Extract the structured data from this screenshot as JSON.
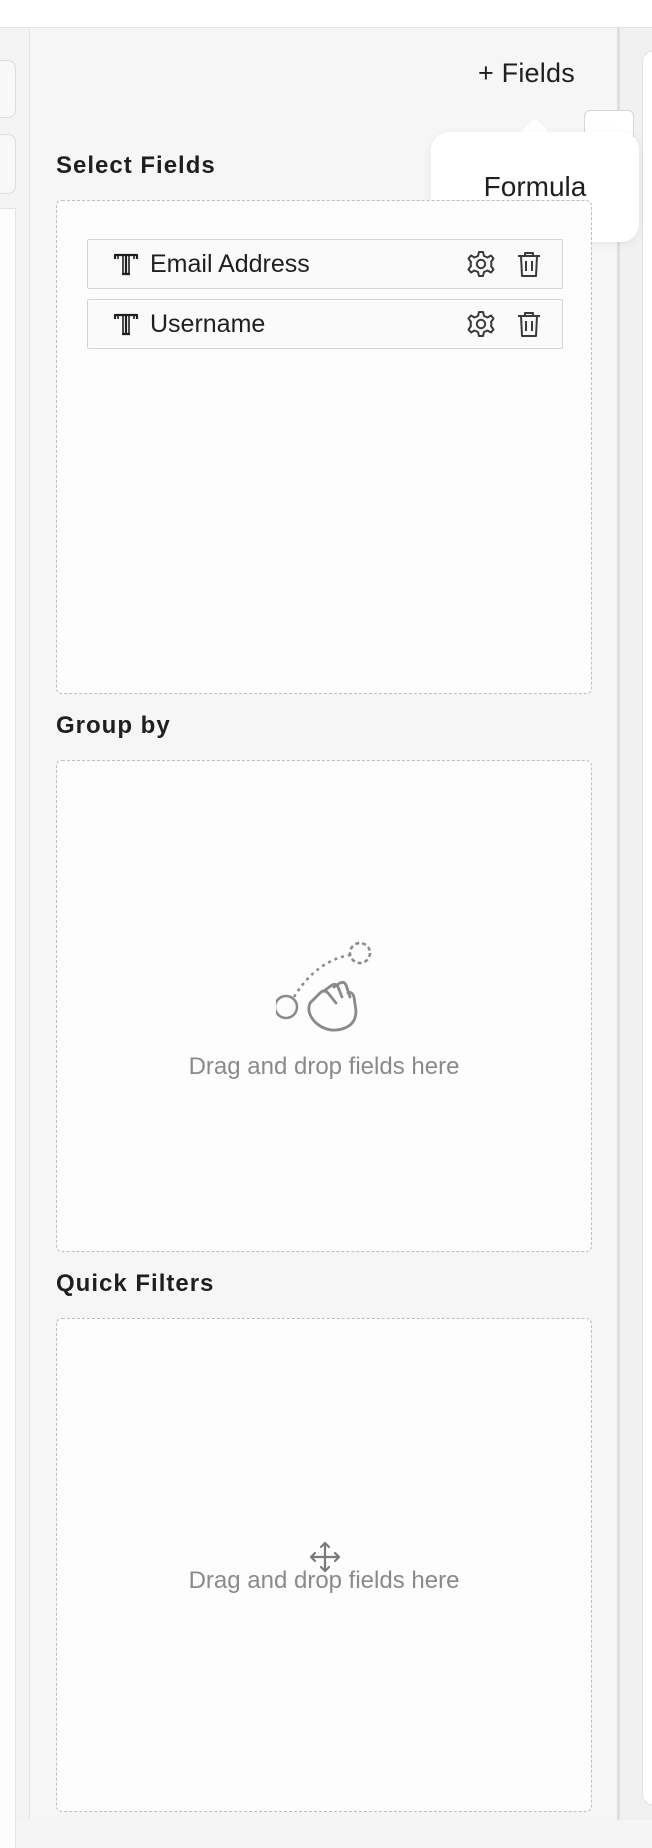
{
  "header": {
    "add_fields_label": "+ Fields"
  },
  "popover": {
    "items": [
      {
        "label": "Formula"
      }
    ]
  },
  "select_fields": {
    "title": "Select Fields",
    "fields": [
      {
        "label": "Email Address",
        "type_icon": "text-type-icon"
      },
      {
        "label": "Username",
        "type_icon": "text-type-icon"
      }
    ]
  },
  "group_by": {
    "title": "Group by",
    "empty_hint": "Drag and drop fields here",
    "icon": "drag-hand-icon"
  },
  "quick_filters": {
    "title": "Quick Filters",
    "empty_hint": "Drag and drop fields here",
    "icon": "move-icon"
  },
  "colors": {
    "text": "#1f1f1f",
    "muted": "#8a8a8a",
    "dashed_border": "#bdbdbd"
  }
}
